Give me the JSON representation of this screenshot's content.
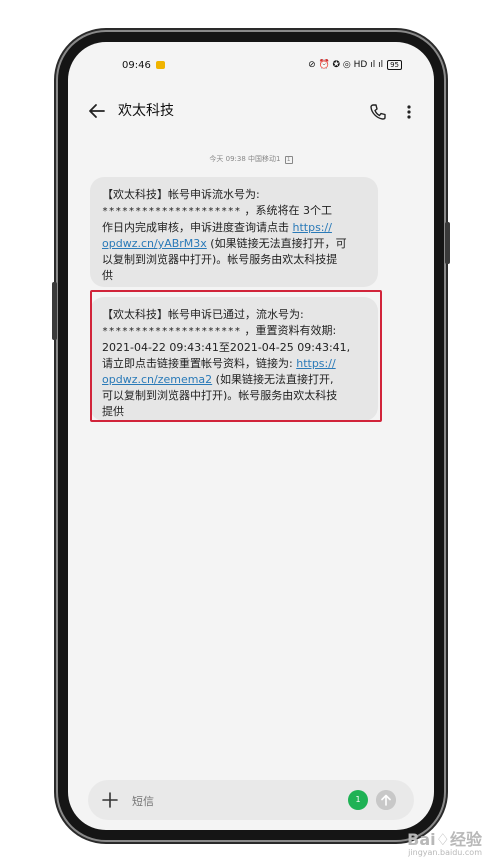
{
  "status_bar": {
    "time": "09:46",
    "icons": "⊘ ⏰ ✪ ◎ HD ıl ıl",
    "battery": "95"
  },
  "app_bar": {
    "title": "欢太科技"
  },
  "thread": {
    "timestamp": "今天 09:38",
    "carrier": "中国移动1",
    "sim": "1"
  },
  "messages": [
    {
      "line1": "【欢太科技】帐号申诉流水号为:",
      "stars": "*********************",
      "line2_tail": "，系统将在 3个工",
      "line3": "作日内完成审核，申诉进度查询请点击",
      "link_part1": "https://",
      "link_part2": "opdwz.cn/yABrM3x",
      "line4_tail": "(如果链接无法直接打开，可",
      "line5": "以复制到浏览器中打开)。帐号服务由欢太科技提",
      "line6": "供"
    },
    {
      "line1": "【欢太科技】帐号申诉已通过，流水号为:",
      "stars": "*********************",
      "line2_tail": "，重置资料有效期:",
      "line3": "2021-04-22 09:43:41至2021-04-25 09:43:41,",
      "line4_head": "请立即点击链接重置帐号资料，链接为:",
      "link_part1": "https://",
      "link_part2": "opdwz.cn/zemema2",
      "line5_tail": "(如果链接无法直接打开,",
      "line6": "可以复制到浏览器中打开)。帐号服务由欢太科技",
      "line7": "提供"
    }
  ],
  "compose": {
    "placeholder": "短信",
    "sim_label": "1"
  },
  "watermark": {
    "main": "Bai♢经验",
    "sub": "jingyan.baidu.com"
  },
  "colors": {
    "link": "#2a7ab8",
    "highlight": "#d1243a",
    "sim_chip": "#1fb255"
  }
}
